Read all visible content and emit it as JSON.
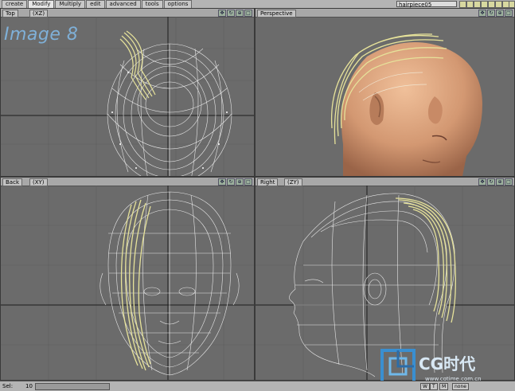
{
  "toolbar": {
    "tabs": [
      {
        "label": "create",
        "active": false
      },
      {
        "label": "Modify",
        "active": true
      },
      {
        "label": "Multiply",
        "active": false
      },
      {
        "label": "edit",
        "active": false
      },
      {
        "label": "advanced",
        "active": false
      },
      {
        "label": "tools",
        "active": false
      },
      {
        "label": "options",
        "active": false
      }
    ],
    "layer_name": "hairpiece05"
  },
  "image_label": "Image 8",
  "viewports": {
    "top": {
      "title": "Top",
      "axis": "(XZ)"
    },
    "perspective": {
      "title": "Perspective"
    },
    "back": {
      "title": "Back",
      "axis": "(XY)"
    },
    "right": {
      "title": "Right",
      "axis": "(ZY)"
    }
  },
  "status": {
    "sel_label": "Sel:",
    "sel_count": "10",
    "mode_w": "W",
    "mode_t": "T",
    "mode_m": "M",
    "mode_none": "none"
  },
  "watermark": {
    "brand": "CG时代",
    "url": "www.cgtime.com.cn"
  },
  "colors": {
    "wire": "#e8e8e8",
    "hair": "#e6e29a",
    "skin": "#d9a07a",
    "background": "#6b6b6b",
    "accent": "#7fb0d8"
  },
  "icons": {
    "viewport_controls": [
      "move-view-icon",
      "rotate-view-icon",
      "zoom-view-icon",
      "maximize-view-icon"
    ]
  }
}
